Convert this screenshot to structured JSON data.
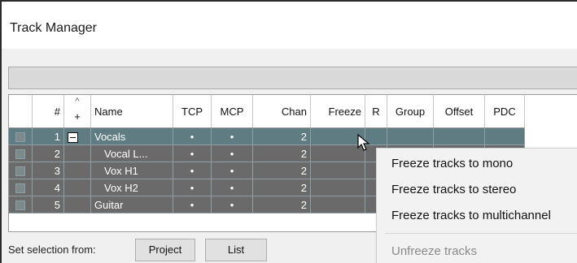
{
  "window": {
    "title": "Track Manager"
  },
  "grid": {
    "columns": {
      "num": "#",
      "fold_indicator": "^",
      "fold": "+",
      "name": "Name",
      "tcp": "TCP",
      "mcp": "MCP",
      "chan": "Chan",
      "freeze": "Freeze",
      "r": "R",
      "group": "Group",
      "offset": "Offset",
      "pdc": "PDC"
    },
    "rows": [
      {
        "num": "1",
        "name": "Vocals",
        "tcp": "•",
        "mcp": "•",
        "chan": "2"
      },
      {
        "num": "2",
        "name": "Vocal L...",
        "tcp": "•",
        "mcp": "•",
        "chan": "2"
      },
      {
        "num": "3",
        "name": "Vox H1",
        "tcp": "•",
        "mcp": "•",
        "chan": "2"
      },
      {
        "num": "4",
        "name": "Vox H2",
        "tcp": "•",
        "mcp": "•",
        "chan": "2"
      },
      {
        "num": "5",
        "name": "Guitar",
        "tcp": "•",
        "mcp": "•",
        "chan": "2"
      }
    ]
  },
  "footer": {
    "label": "Set selection from:",
    "project_button": "Project",
    "list_button": "List"
  },
  "context_menu": {
    "items": [
      "Freeze tracks to mono",
      "Freeze tracks to stereo",
      "Freeze tracks to multichannel",
      "Unfreeze tracks"
    ]
  }
}
